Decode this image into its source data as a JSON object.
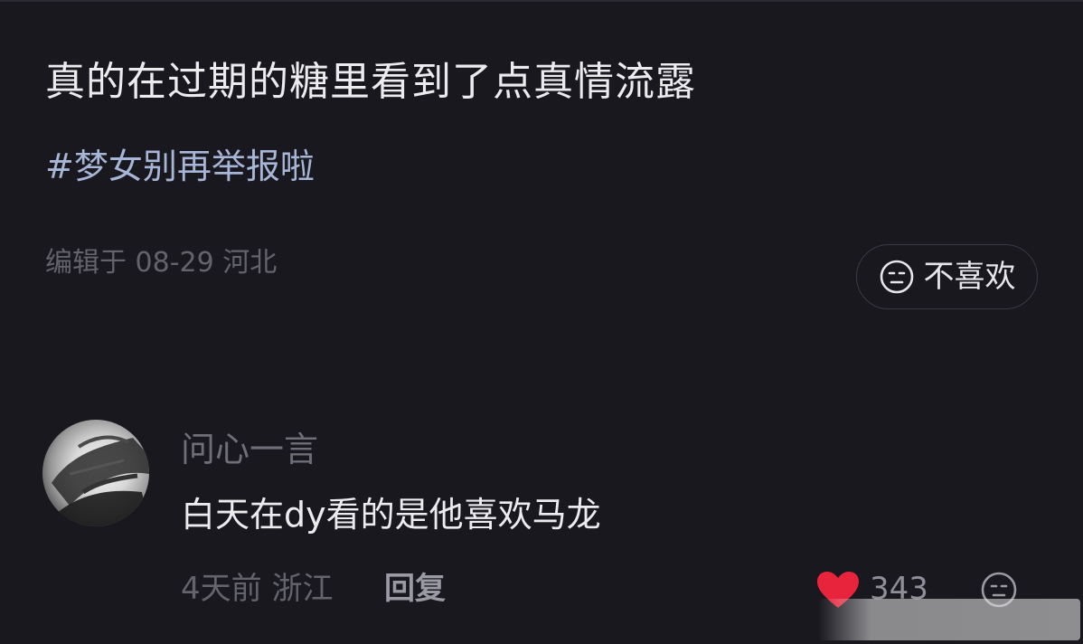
{
  "post": {
    "title": "真的在过期的糖里看到了点真情流露",
    "hashtag": "#梦女别再举报啦",
    "meta": "编辑于 08-29 河北",
    "dislike_label": "不喜欢"
  },
  "comment": {
    "username": "问心一言",
    "text": "白天在dy看的是他喜欢马龙",
    "meta": "4天前 浙江",
    "reply_label": "回复",
    "like_count": "343"
  },
  "colors": {
    "background": "#19181e",
    "hashtag": "#a7b6d6",
    "like": "#e8243c"
  },
  "icons": {
    "dislike": "neutral-face-icon",
    "like": "heart-icon",
    "comment_dislike": "neutral-face-icon"
  }
}
